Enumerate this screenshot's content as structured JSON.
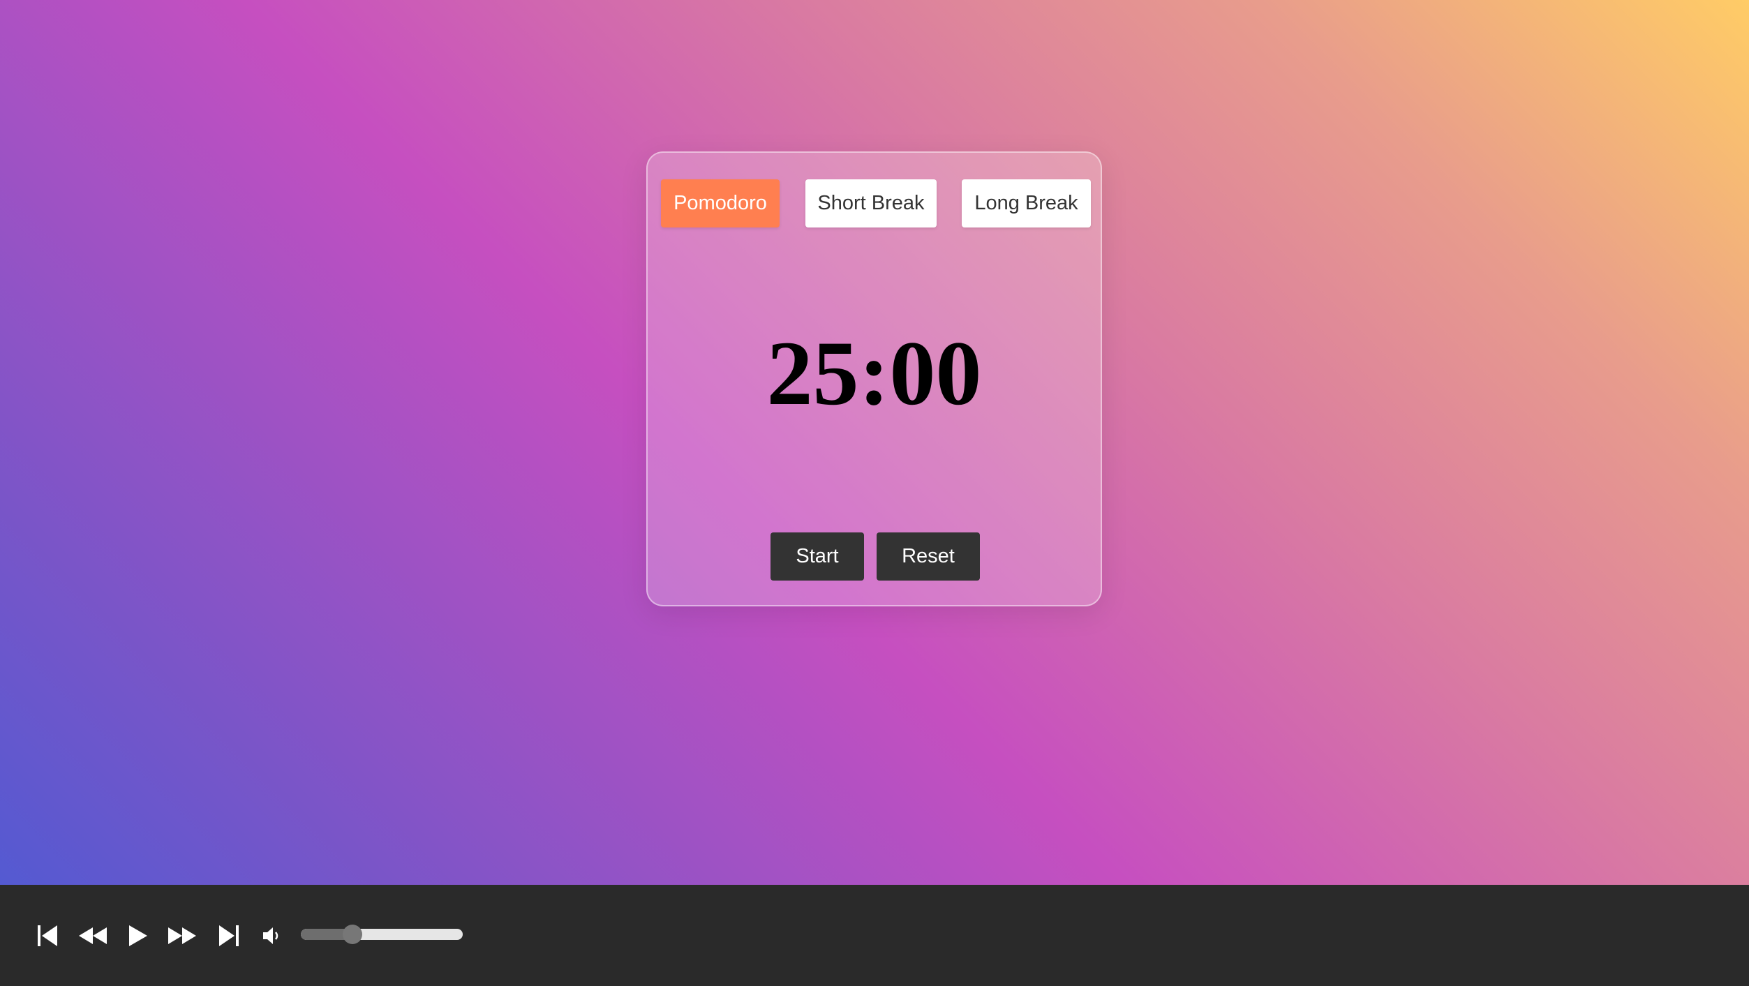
{
  "timer": {
    "modes": [
      {
        "label": "Pomodoro",
        "active": true
      },
      {
        "label": "Short Break",
        "active": false
      },
      {
        "label": "Long Break",
        "active": false
      }
    ],
    "time": "25:00",
    "start_label": "Start",
    "reset_label": "Reset"
  },
  "player": {
    "buttons": [
      "skip-back-icon",
      "rewind-icon",
      "play-icon",
      "fast-forward-icon",
      "skip-forward-icon",
      "volume-icon"
    ],
    "volume": 0.32
  },
  "colors": {
    "active_mode": "#ff7f50",
    "control_button": "#333333",
    "player_bar": "#2a2a2a"
  }
}
